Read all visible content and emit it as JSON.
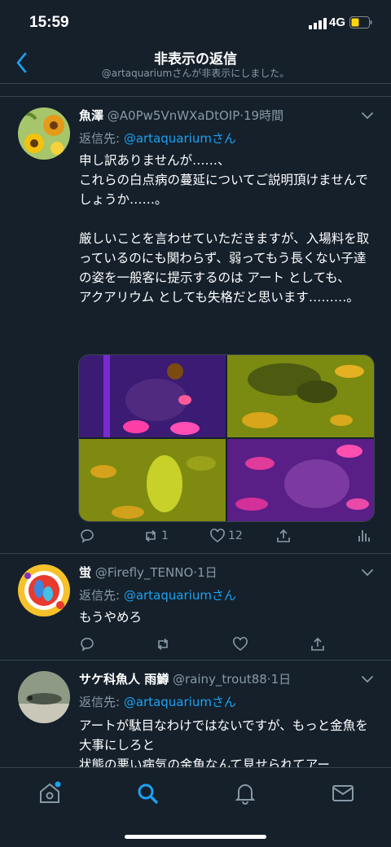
{
  "status": {
    "time": "15:59",
    "network": "4G"
  },
  "nav": {
    "title": "非表示の返信",
    "subtitle": "@artaquariumさんが非表示にしました。"
  },
  "tweets": [
    {
      "name": "魚澤",
      "handle": "@A0Pw5VnWXaDtOIP",
      "dot": "·",
      "ago": "19時間",
      "reply_prefix": "返信先: ",
      "reply_to": "@artaquariumさん",
      "text": "申し訳ありませんが……、\nこれらの白点病の蔓延についてご説明頂けませんでしょうか……。\n\n厳しいことを言わせていただきますが、入場料を取っているのにも関わらず、弱ってもう長くない子達の姿を一般客に提示するのは アート としても、\nアクアリウム としても失格だと思います………。",
      "retweets": "1",
      "likes": "12"
    },
    {
      "name": "蛍",
      "handle": "@Firefly_TENNO",
      "dot": "·",
      "ago": "1日",
      "reply_prefix": "返信先: ",
      "reply_to": "@artaquariumさん",
      "text": "もうやめろ"
    },
    {
      "name": "サケ科魚人 雨鱒",
      "handle": "@rainy_trout88",
      "dot": "·",
      "ago": "1日",
      "reply_prefix": "返信先: ",
      "reply_to": "@artaquariumさん",
      "text": "アートが駄目なわけではないですが、もっと金魚を大事にしろと\n状態の悪い病気の金魚なんて見せられてアー"
    }
  ],
  "icons": {
    "back": "chevron-left-icon",
    "reply": "reply-icon",
    "retweet": "retweet-icon",
    "like": "heart-icon",
    "share": "share-icon",
    "analytics": "analytics-icon",
    "tabs": [
      "home-icon",
      "search-icon",
      "notifications-icon",
      "messages-icon"
    ]
  },
  "colors": {
    "background": "#15202b",
    "accent": "#1da1f2",
    "muted": "#8899a6",
    "divider": "#38444d"
  }
}
